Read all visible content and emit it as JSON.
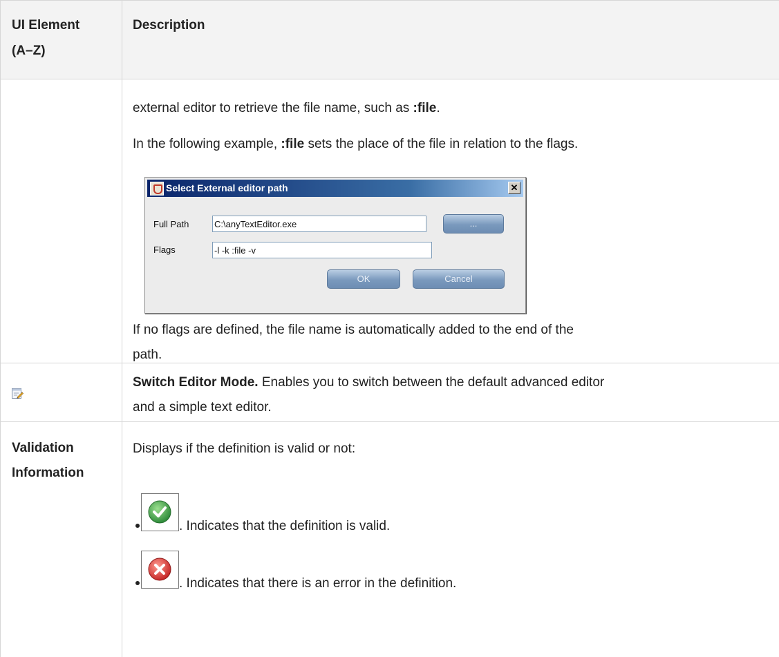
{
  "header": {
    "col1_line1": "UI Element",
    "col1_line2": "(A–Z)",
    "col2": "Description"
  },
  "row1": {
    "line1_text": "external editor to retrieve the file name, such as ",
    "line1_bold": ":file",
    "line1_end": ".",
    "line2_text": "In the following example, ",
    "line2_bold": ":file",
    "line2_end": " sets the place of the file in relation to the flags.",
    "dialog": {
      "title": "Select External editor path",
      "close": "✕",
      "full_path_label": "Full Path",
      "full_path_value": "C:\\anyTextEditor.exe",
      "browse_button": "...",
      "flags_label": "Flags",
      "flags_value": "-l -k :file -v",
      "ok_button": "OK",
      "cancel_button": "Cancel"
    },
    "line3": "If no flags are defined, the file name is automatically added to the end of the",
    "line4": "path."
  },
  "row2": {
    "icon": "switch-editor-mode-icon",
    "title": "Switch Editor Mode.",
    "text1": " Enables you to switch between the default advanced editor",
    "text2": "and a simple text editor."
  },
  "row3": {
    "label_line1": "Validation",
    "label_line2": "Information",
    "intro": "Displays if the definition is valid or not:",
    "valid_icon": "valid-check-icon",
    "valid_text": ". Indicates that the definition is valid.",
    "error_icon": "error-x-icon",
    "error_text": ". Indicates that there is an error in the definition.",
    "colors": {
      "valid": "#43a047",
      "error": "#e53935"
    }
  }
}
